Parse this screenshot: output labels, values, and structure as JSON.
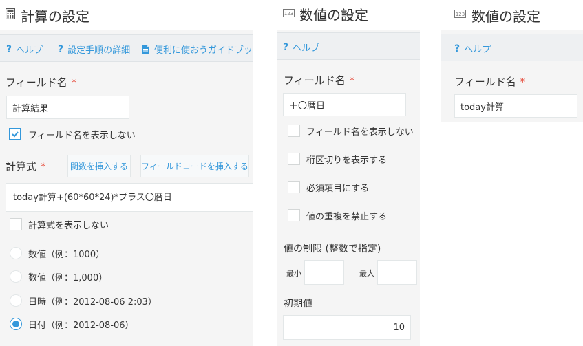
{
  "panel_calc": {
    "title": "計算の設定",
    "help_links": [
      "ヘルプ",
      "設定手順の詳細",
      "便利に使おうガイドブック"
    ],
    "field_name_label": "フィールド名",
    "required_mark": "*",
    "field_name_value": "計算結果",
    "hide_field_name": {
      "label": "フィールド名を表示しない",
      "checked": true
    },
    "formula_label": "計算式",
    "insert_function_button": "関数を挿入する",
    "insert_field_code_button": "フィールドコードを挿入する",
    "formula_value": "today計算+(60*60*24)*プラス〇暦日",
    "hide_formula": {
      "label": "計算式を表示しない",
      "checked": false
    },
    "format_options": [
      {
        "label": "数値（例：1000）",
        "selected": false
      },
      {
        "label": "数値（例：1,000）",
        "selected": false
      },
      {
        "label": "日時（例：2012-08-06 2:03）",
        "selected": false
      },
      {
        "label": "日付（例：2012-08-06）",
        "selected": true
      }
    ]
  },
  "panel_number": {
    "title": "数値の設定",
    "help_link": "ヘルプ",
    "field_name_label": "フィールド名",
    "required_mark": "*",
    "field_name_value": "＋〇暦日",
    "options": [
      {
        "label": "フィールド名を表示しない",
        "checked": false
      },
      {
        "label": "桁区切りを表示する",
        "checked": false
      },
      {
        "label": "必須項目にする",
        "checked": false
      },
      {
        "label": "値の重複を禁止する",
        "checked": false
      }
    ],
    "limit_label": "値の制限 (整数で指定)",
    "min_label": "最小",
    "max_label": "最大",
    "min_value": "",
    "max_value": "",
    "default_label": "初期値",
    "default_value": "10"
  },
  "panel_number2": {
    "title": "数値の設定",
    "help_link": "ヘルプ",
    "field_name_label": "フィールド名",
    "required_mark": "*",
    "field_name_value": "today計算"
  },
  "colors": {
    "accent": "#3498db",
    "required": "#e74c3c",
    "panel_bg": "#f5f5f5",
    "help_bar_bg": "#eef0f2"
  },
  "icons": {
    "calc_title": "calculator-icon",
    "number_title": "number-123-icon",
    "help": "question-mark-icon",
    "document": "document-icon",
    "check": "check-icon"
  }
}
